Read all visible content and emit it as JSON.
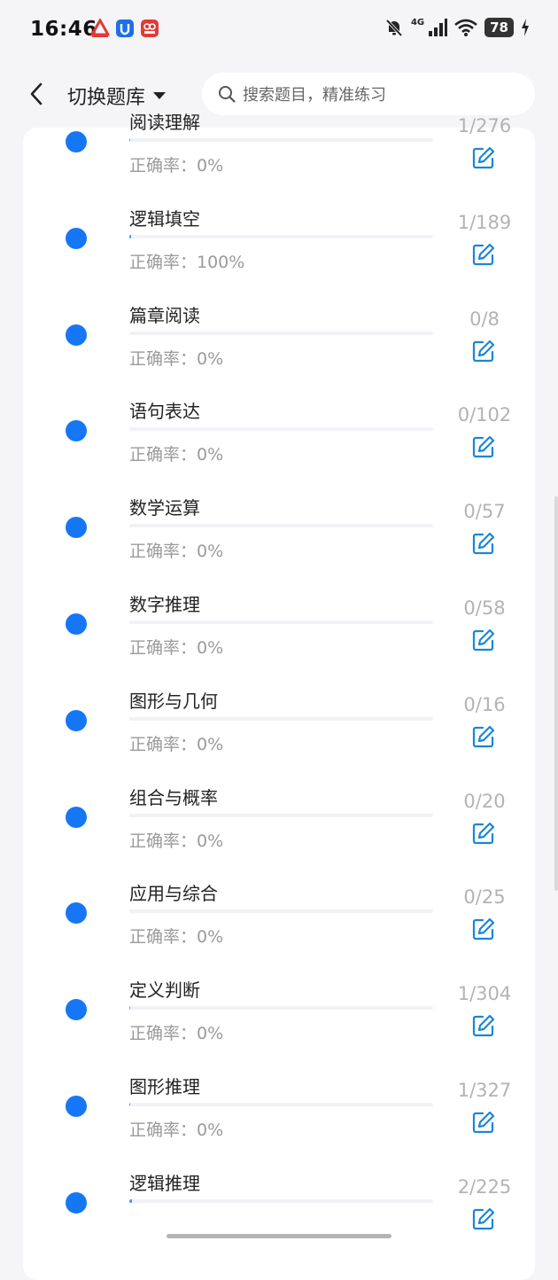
{
  "status": {
    "time": "16:46",
    "network": "4G",
    "battery": "78"
  },
  "header": {
    "bank_label": "切换题库",
    "search_placeholder": "搜索题目，精准练习"
  },
  "rows": [
    {
      "title": "阅读理解",
      "progress": 0.0036,
      "accuracy": "正确率：0%",
      "count": "1/276"
    },
    {
      "title": "逻辑填空",
      "progress": 0.0053,
      "accuracy": "正确率：100%",
      "count": "1/189"
    },
    {
      "title": "篇章阅读",
      "progress": 0,
      "accuracy": "正确率：0%",
      "count": "0/8"
    },
    {
      "title": "语句表达",
      "progress": 0,
      "accuracy": "正确率：0%",
      "count": "0/102"
    },
    {
      "title": "数学运算",
      "progress": 0,
      "accuracy": "正确率：0%",
      "count": "0/57"
    },
    {
      "title": "数字推理",
      "progress": 0,
      "accuracy": "正确率：0%",
      "count": "0/58"
    },
    {
      "title": "图形与几何",
      "progress": 0,
      "accuracy": "正确率：0%",
      "count": "0/16"
    },
    {
      "title": "组合与概率",
      "progress": 0,
      "accuracy": "正确率：0%",
      "count": "0/20"
    },
    {
      "title": "应用与综合",
      "progress": 0,
      "accuracy": "正确率：0%",
      "count": "0/25"
    },
    {
      "title": "定义判断",
      "progress": 0.0033,
      "accuracy": "正确率：0%",
      "count": "1/304"
    },
    {
      "title": "图形推理",
      "progress": 0.0031,
      "accuracy": "正确率：0%",
      "count": "1/327"
    },
    {
      "title": "逻辑推理",
      "progress": 0.0089,
      "accuracy": "",
      "count": "2/225"
    }
  ],
  "colors": {
    "accent": "#1577f6",
    "progress": "#3aa0e8"
  }
}
